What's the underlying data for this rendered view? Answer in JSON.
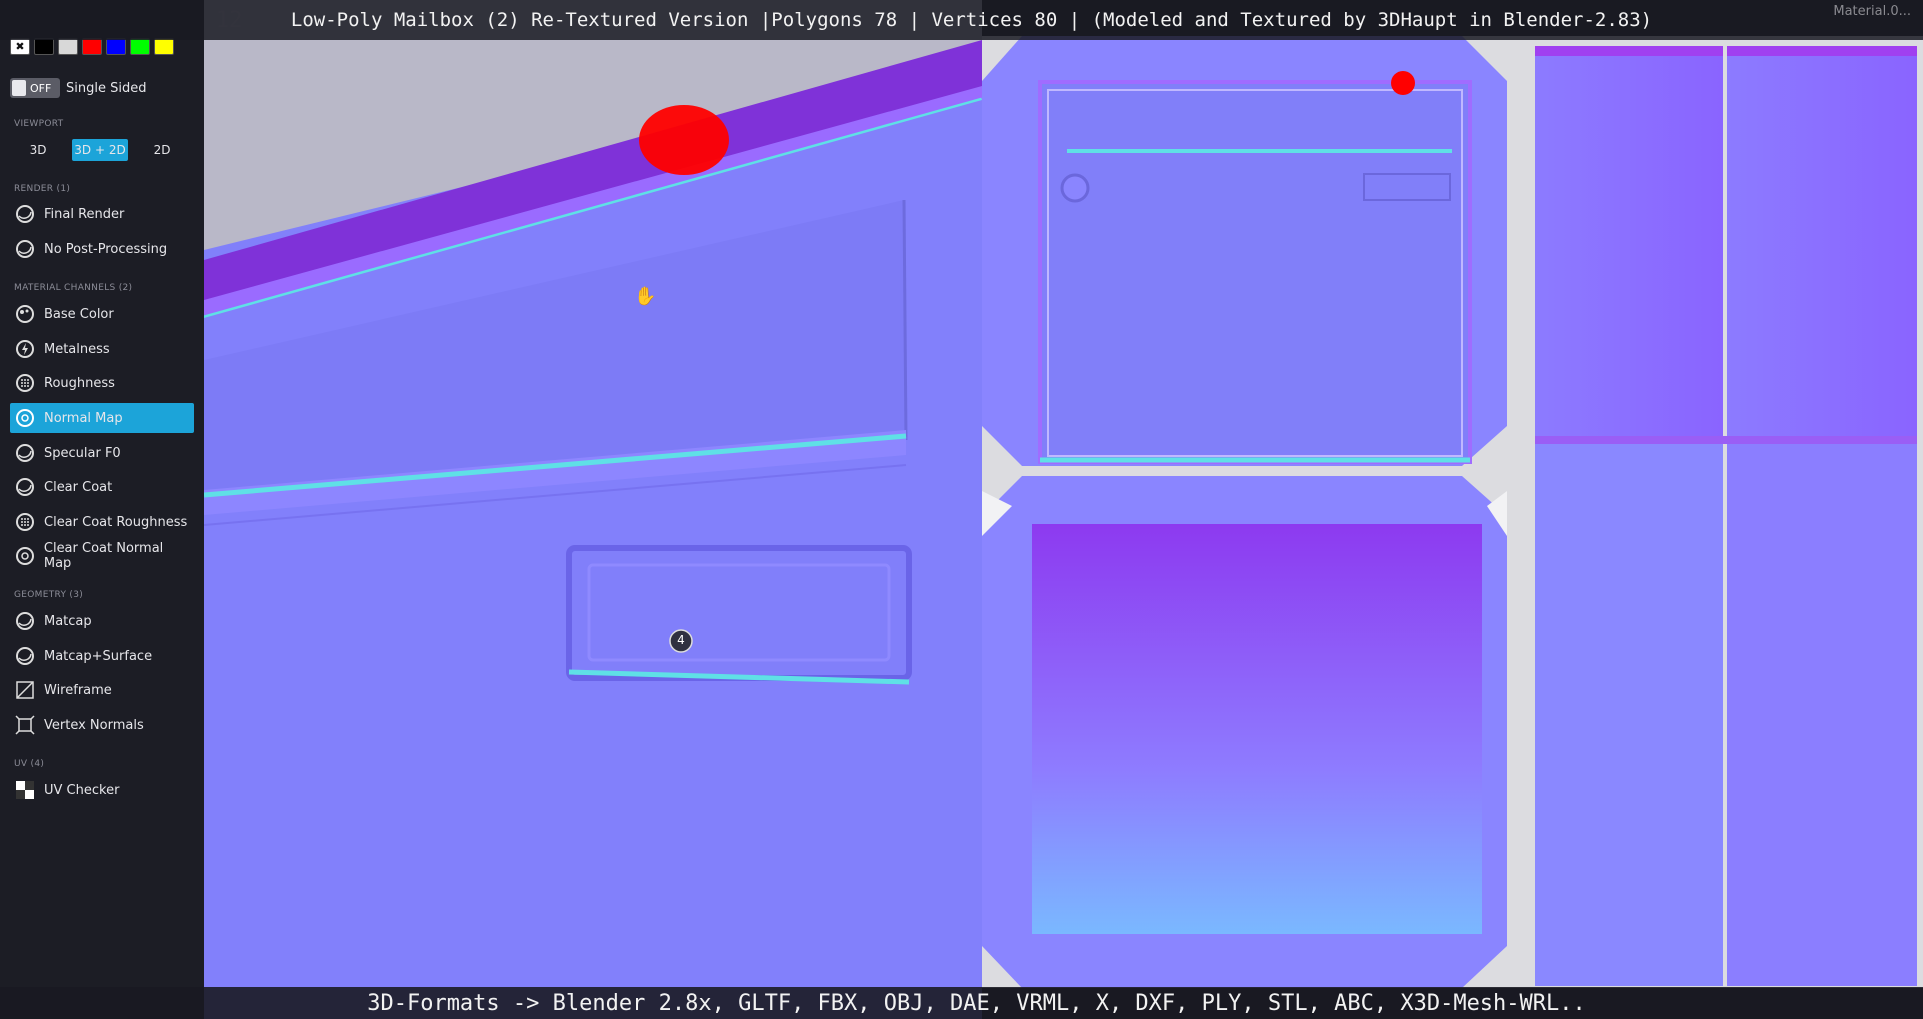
{
  "title": "Low-Poly Mailbox (2) Re-Textured Version |Polygons 78 | Vertices 80 | (Modeled and Textured by 3DHaupt in Blender-2.83)",
  "footer": "3D-Formats -> Blender 2.8x, GLTF, FBX, OBJ, DAE, VRML, X, DXF, PLY, STL, ABC, X3D-Mesh-WRL..",
  "top_right_label": "Material.0...",
  "colors": {
    "accent": "#1ca4d9",
    "normal_map_base": "#8080ff",
    "sidebar_bg": "#1c1d25",
    "marker": "#ff0000"
  },
  "sidebar": {
    "swatches": [
      "#ffffff",
      "#000000",
      "#d8d8d8",
      "#ff0000",
      "#0000ff",
      "#00ff00",
      "#ffff00"
    ],
    "single_sided": {
      "state": "OFF",
      "label": "Single Sided"
    },
    "viewport_label": "VIEWPORT",
    "viewport_modes": [
      "3D",
      "3D + 2D",
      "2D"
    ],
    "render_label": "RENDER (1)",
    "render_items": [
      {
        "label": "Final Render",
        "icon": "sphere-icon"
      },
      {
        "label": "No Post-Processing",
        "icon": "sphere-icon"
      }
    ],
    "material_label": "MATERIAL CHANNELS (2)",
    "material_items": [
      {
        "label": "Base Color",
        "icon": "palette-icon"
      },
      {
        "label": "Metalness",
        "icon": "bolt-icon"
      },
      {
        "label": "Roughness",
        "icon": "dots-sphere-icon"
      },
      {
        "label": "Normal Map",
        "icon": "normal-map-icon",
        "active": true
      },
      {
        "label": "Specular F0",
        "icon": "sphere-icon"
      },
      {
        "label": "Clear Coat",
        "icon": "sphere-icon"
      },
      {
        "label": "Clear Coat Roughness",
        "icon": "dots-sphere-icon"
      },
      {
        "label": "Clear Coat Normal Map",
        "icon": "normal-map-icon"
      }
    ],
    "geometry_label": "GEOMETRY (3)",
    "geometry_items": [
      {
        "label": "Matcap",
        "icon": "sphere-icon"
      },
      {
        "label": "Matcap+Surface",
        "icon": "sphere-icon"
      },
      {
        "label": "Wireframe",
        "icon": "wireframe-icon"
      },
      {
        "label": "Vertex Normals",
        "icon": "vertex-normals-icon"
      }
    ],
    "uv_label": "UV (4)",
    "uv_items": [
      {
        "label": "UV Checker",
        "icon": "checker-icon"
      }
    ]
  },
  "annotation_badge": "4"
}
